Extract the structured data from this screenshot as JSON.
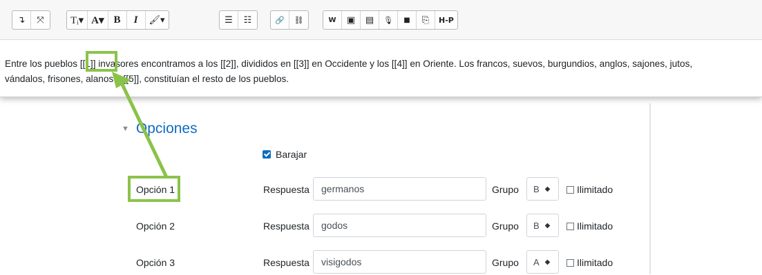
{
  "toolbar": {
    "groups": [
      {
        "buttons": [
          {
            "name": "expand-toolbar-icon",
            "glyph": "↴"
          },
          {
            "name": "fullscreen-icon",
            "glyph": "⤧"
          }
        ]
      },
      {
        "buttons": [
          {
            "name": "paragraph-style-icon",
            "glyph": "Tᵢ▾"
          },
          {
            "name": "font-color-icon",
            "glyph": "A▾"
          },
          {
            "name": "bold-icon",
            "glyph": "B"
          },
          {
            "name": "italic-icon",
            "glyph": "I"
          },
          {
            "name": "brush-icon",
            "glyph": "🖌▾"
          }
        ]
      },
      {
        "buttons": [
          {
            "name": "unordered-list-icon",
            "glyph": "☰"
          },
          {
            "name": "ordered-list-icon",
            "glyph": "☷"
          }
        ]
      },
      {
        "buttons": [
          {
            "name": "link-icon",
            "glyph": "🔗"
          },
          {
            "name": "unlink-icon",
            "glyph": "⛓"
          }
        ]
      },
      {
        "buttons": [
          {
            "name": "wiris-icon",
            "glyph": "W"
          },
          {
            "name": "image-icon",
            "glyph": "▣"
          },
          {
            "name": "media-icon",
            "glyph": "▤"
          },
          {
            "name": "microphone-icon",
            "glyph": "🎙"
          },
          {
            "name": "video-icon",
            "glyph": "■"
          },
          {
            "name": "copy-icon",
            "glyph": "⎘"
          },
          {
            "name": "h5p-icon",
            "glyph": "H-P"
          }
        ]
      }
    ]
  },
  "editor": {
    "line1": "Entre los pueblos [[1]] invasores encontramos a los [[2]], divididos en [[3]] en Occidente y los [[4]] en Oriente. Los francos, suevos, burgundios, anglos, sajones, jutos,",
    "line2": "vándalos, frisones, alanos y [[5]],  constituían el resto de los pueblos."
  },
  "section": {
    "title": "Opciones",
    "shuffle_label": "Barajar"
  },
  "options": [
    {
      "label": "Opción 1",
      "response_label": "Respuesta",
      "response": "germanos",
      "group_label": "Grupo",
      "group": "B",
      "unlimited_label": "Ilimitado"
    },
    {
      "label": "Opción 2",
      "response_label": "Respuesta",
      "response": "godos",
      "group_label": "Grupo",
      "group": "B",
      "unlimited_label": "Ilimitado"
    },
    {
      "label": "Opción 3",
      "response_label": "Respuesta",
      "response": "visigodos",
      "group_label": "Grupo",
      "group": "A",
      "unlimited_label": "Ilimitado"
    }
  ],
  "colors": {
    "annotation": "#8bc34a",
    "accent": "#0f6cbf"
  }
}
